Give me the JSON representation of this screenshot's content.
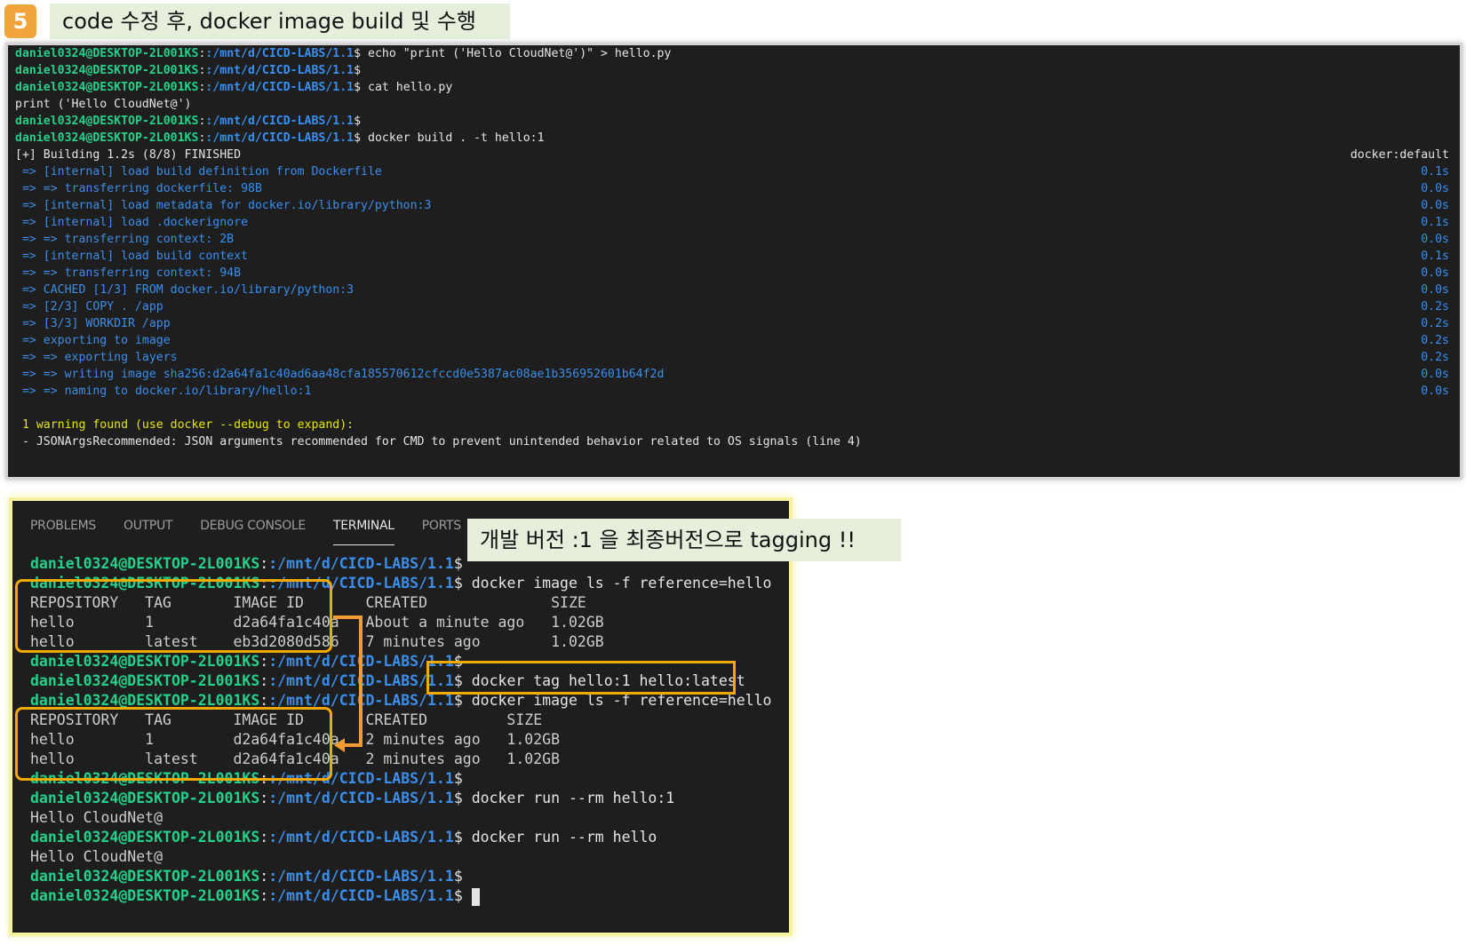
{
  "header": {
    "step_number": "5",
    "title": "code 수정 후, docker image build 및 수행"
  },
  "prompt": {
    "user_host": "daniel0324@DESKTOP-2L001KS",
    "path": ":/mnt/d/CICD-LABS/1.1",
    "symbol": "$"
  },
  "terminal1": {
    "cmd_echo": " echo \"print ('Hello CloudNet@')\" > hello.py",
    "cmd_cat": " cat hello.py",
    "output_cat": "print ('Hello CloudNet@')",
    "cmd_build": " docker build . -t hello:1",
    "building": "[+] Building 1.2s (8/8) FINISHED",
    "builder": "docker:default",
    "steps": [
      {
        "text": " => [internal] load build definition from Dockerfile",
        "time": "0.1s"
      },
      {
        "text": " => => transferring dockerfile: 98B",
        "time": "0.0s"
      },
      {
        "text": " => [internal] load metadata for docker.io/library/python:3",
        "time": "0.0s"
      },
      {
        "text": " => [internal] load .dockerignore",
        "time": "0.1s"
      },
      {
        "text": " => => transferring context: 2B",
        "time": "0.0s"
      },
      {
        "text": " => [internal] load build context",
        "time": "0.1s"
      },
      {
        "text": " => => transferring context: 94B",
        "time": "0.0s"
      },
      {
        "text": " => CACHED [1/3] FROM docker.io/library/python:3",
        "time": "0.0s"
      },
      {
        "text": " => [2/3] COPY . /app",
        "time": "0.2s"
      },
      {
        "text": " => [3/3] WORKDIR /app",
        "time": "0.2s"
      },
      {
        "text": " => exporting to image",
        "time": "0.2s"
      },
      {
        "text": " => => exporting layers",
        "time": "0.2s"
      },
      {
        "text": " => => writing image sha256:d2a64fa1c40ad6aa48cfa185570612cfccd0e5387ac08ae1b356952601b64f2d",
        "time": "0.0s"
      },
      {
        "text": " => => naming to docker.io/library/hello:1",
        "time": "0.0s"
      }
    ],
    "warning": " 1 warning found (use docker --debug to expand):",
    "warning_detail": " - JSONArgsRecommended: JSON arguments recommended for CMD to prevent unintended behavior related to OS signals (line 4)"
  },
  "terminal2": {
    "tabs": [
      "PROBLEMS",
      "OUTPUT",
      "DEBUG CONSOLE",
      "TERMINAL",
      "PORTS"
    ],
    "cmd_ls": " docker image ls -f reference=hello",
    "table1_header": "REPOSITORY   TAG       IMAGE ID       CREATED              SIZE",
    "table1_row1": "hello        1         d2a64fa1c40a   About a minute ago   1.02GB",
    "table1_row2": "hello        latest    eb3d2080d586   7 minutes ago        1.02GB",
    "cmd_tag": " docker tag hello:1 hello:latest",
    "table2_header": "REPOSITORY   TAG       IMAGE ID       CREATED         SIZE",
    "table2_row1": "hello        1         d2a64fa1c40a   2 minutes ago   1.02GB",
    "table2_row2": "hello        latest    d2a64fa1c40a   2 minutes ago   1.02GB",
    "cmd_run1": " docker run --rm hello:1",
    "out_run1": "Hello CloudNet@",
    "cmd_run2": " docker run --rm hello",
    "out_run2": "Hello CloudNet@"
  },
  "annotation": {
    "note": "개발 버전 :1 을 최종버전으로 tagging !!",
    "highlight_color": "#f2a900",
    "arrow_color": "#f39c32"
  }
}
